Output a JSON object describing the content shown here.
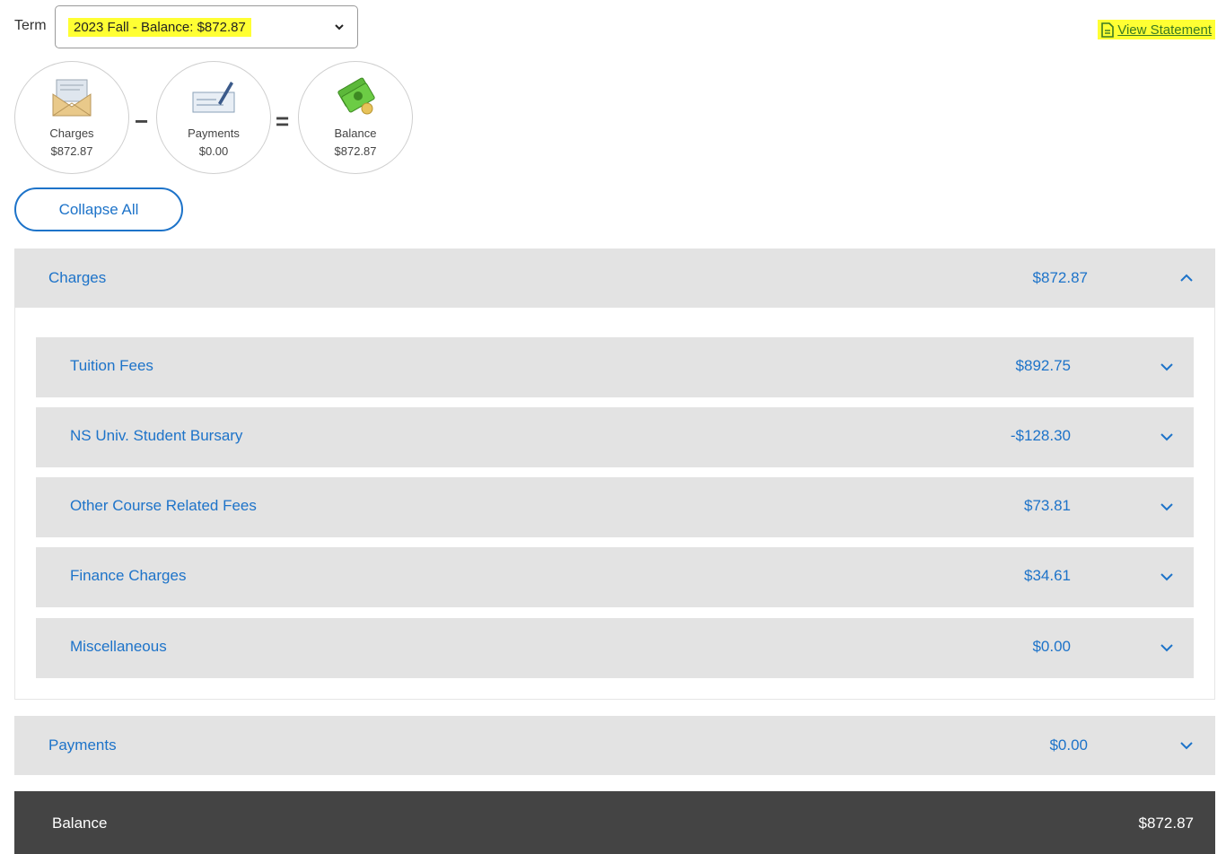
{
  "term": {
    "label": "Term",
    "selected": "2023 Fall - Balance: $872.87"
  },
  "view_statement": "View Statement",
  "summary": {
    "charges": {
      "label": "Charges",
      "amount": "$872.87",
      "icon": "envelope-icon"
    },
    "minus": "−",
    "payments": {
      "label": "Payments",
      "amount": "$0.00",
      "icon": "check-pen-icon"
    },
    "equals": "=",
    "balance": {
      "label": "Balance",
      "amount": "$872.87",
      "icon": "money-icon"
    }
  },
  "collapse_all": "Collapse All",
  "charges_section": {
    "label": "Charges",
    "amount": "$872.87",
    "items": [
      {
        "label": "Tuition Fees",
        "amount": "$892.75"
      },
      {
        "label": "NS Univ. Student Bursary",
        "amount": "-$128.30"
      },
      {
        "label": "Other Course Related Fees",
        "amount": "$73.81"
      },
      {
        "label": "Finance Charges",
        "amount": "$34.61"
      },
      {
        "label": "Miscellaneous",
        "amount": "$0.00"
      }
    ]
  },
  "payments_section": {
    "label": "Payments",
    "amount": "$0.00"
  },
  "balance_footer": {
    "label": "Balance",
    "amount": "$872.87"
  },
  "colors": {
    "accent": "#1d73c9",
    "highlight": "#ffff33",
    "row_bg": "#e3e3e3",
    "footer_bg": "#444444"
  }
}
